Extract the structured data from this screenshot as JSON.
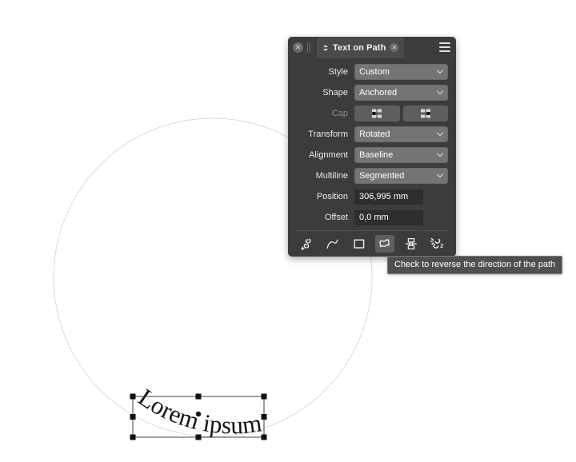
{
  "panel": {
    "title": "Text on Path",
    "window_close_icon": "close-icon",
    "tab_close_icon": "close-icon",
    "menu_icon": "hamburger-menu-icon",
    "rows": [
      {
        "label": "Style",
        "type": "select",
        "value": "Custom",
        "disabled": false
      },
      {
        "label": "Shape",
        "type": "select",
        "value": "Anchored",
        "disabled": false
      },
      {
        "label": "Cap",
        "type": "capgroup",
        "value": "",
        "disabled": true
      },
      {
        "label": "Transform",
        "type": "select",
        "value": "Rotated",
        "disabled": false
      },
      {
        "label": "Alignment",
        "type": "select",
        "value": "Baseline",
        "disabled": false
      },
      {
        "label": "Multiline",
        "type": "select",
        "value": "Segmented",
        "disabled": false
      },
      {
        "label": "Position",
        "type": "field",
        "value": "306,995 mm",
        "disabled": false
      },
      {
        "label": "Offset",
        "type": "field",
        "value": "0,0 mm",
        "disabled": false
      }
    ],
    "cap_buttons": [
      {
        "name": "cap-start-button"
      },
      {
        "name": "cap-end-button"
      }
    ],
    "tools": [
      {
        "name": "attach-text-to-path-icon",
        "active": false
      },
      {
        "name": "curve-path-icon",
        "active": false
      },
      {
        "name": "rectangle-path-icon",
        "active": false
      },
      {
        "name": "reverse-path-direction-icon",
        "active": true
      },
      {
        "name": "flip-text-icon",
        "active": false
      },
      {
        "name": "detach-text-from-path-icon",
        "active": false
      }
    ]
  },
  "tooltip": {
    "text": "Check to reverse the direction of the path"
  },
  "canvas": {
    "text_object": "Lorem ipsum",
    "path_shape": "circle",
    "path_stroke_color": "#d9d9d9",
    "selection_handle_color": "#1a1a1a",
    "selection_box_color": "#444444"
  }
}
